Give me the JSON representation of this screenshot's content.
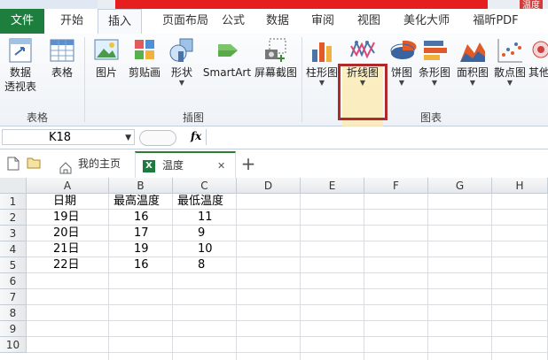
{
  "window": {
    "caption": "温度"
  },
  "ribbon_tabs": [
    "文件",
    "开始",
    "插入",
    "页面布局",
    "公式",
    "数据",
    "审阅",
    "视图",
    "美化大师",
    "福昕PDF"
  ],
  "ribbon": {
    "groups": {
      "tables": "表格",
      "illustrations": "插图",
      "charts": "图表"
    },
    "pivot_label_1": "数据",
    "pivot_label_2": "透视表",
    "table": "表格",
    "picture": "图片",
    "clipart": "剪贴画",
    "shapes": "形状",
    "smartart": "SmartArt",
    "screenshot": "屏幕截图",
    "column": "柱形图",
    "line": "折线图",
    "pie": "饼图",
    "bar": "条形图",
    "area": "面积图",
    "scatter": "散点图",
    "other": "其他"
  },
  "formula_bar": {
    "name_box": "K18",
    "fx": "fx",
    "value": ""
  },
  "workbook_tabs": {
    "home": "我的主页",
    "file": "温度",
    "close": "✕",
    "add": "+"
  },
  "sheet": {
    "columns": [
      "A",
      "B",
      "C",
      "D",
      "E",
      "F",
      "G",
      "H"
    ],
    "rows": [
      "1",
      "2",
      "3",
      "4",
      "5",
      "6",
      "7",
      "8",
      "9",
      "10"
    ],
    "cells": [
      [
        "日期",
        "最高温度",
        "最低温度"
      ],
      [
        "19日",
        "16",
        "11"
      ],
      [
        "20日",
        "17",
        "9"
      ],
      [
        "21日",
        "19",
        "10"
      ],
      [
        "22日",
        "16",
        "8"
      ]
    ]
  },
  "colors": {
    "file_tab": "#1d7e3e",
    "highlight": "#b02a2a",
    "title_red": "#e61e1e"
  }
}
